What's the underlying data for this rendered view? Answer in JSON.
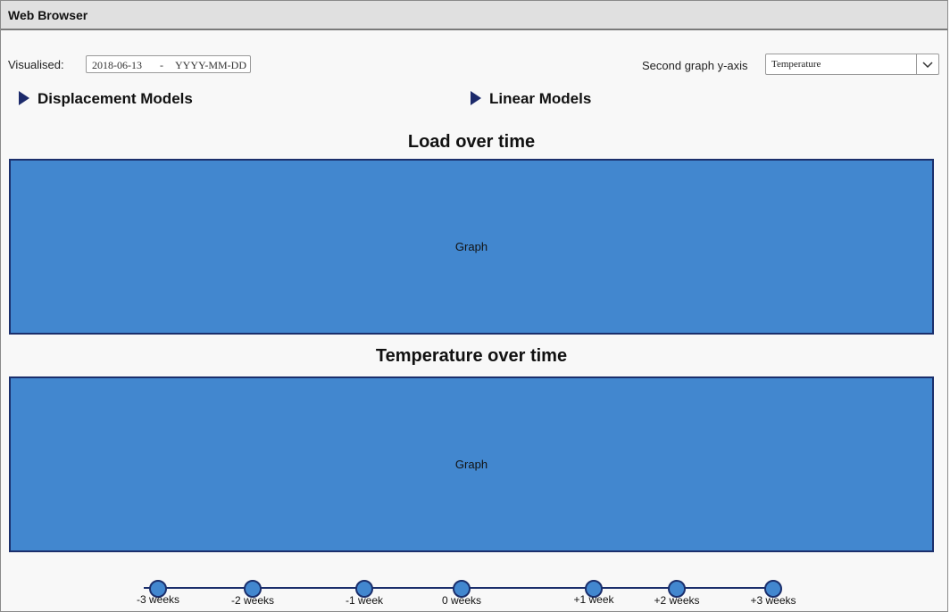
{
  "window": {
    "title": "Web Browser"
  },
  "filters": {
    "visualised_label": "Visualised:",
    "date_start": "2018-06-13",
    "date_separator": "-",
    "date_end_placeholder": "YYYY-MM-DD",
    "second_axis_label": "Second graph y-axis",
    "second_axis_value": "Temperature"
  },
  "sections": {
    "displacement_models": "Displacement Models",
    "linear_models": "Linear Models"
  },
  "graphs": [
    {
      "title": "Load over time",
      "placeholder": "Graph"
    },
    {
      "title": "Temperature over time",
      "placeholder": "Graph"
    }
  ],
  "timeline": {
    "labels": [
      "-3 weeks",
      "-2 weeks",
      "-1 week",
      "0 weeks",
      "+1 week",
      "+2 weeks",
      "+3 weeks"
    ]
  },
  "colors": {
    "graph_fill": "#4287cf",
    "graph_border": "#1b2f6c",
    "expander_arrow": "#1c2a6b"
  },
  "icons": {
    "expander": "triangle-right-icon",
    "select": "chevron-down-icon"
  }
}
